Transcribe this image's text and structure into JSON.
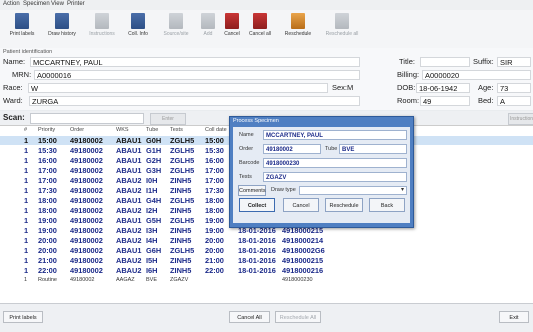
{
  "menu": [
    "Action",
    "Specimen",
    "View",
    "Printer"
  ],
  "toolbar": [
    {
      "label": "Print labels",
      "icon": "print-labels-icon",
      "enabled": true
    },
    {
      "label": "Draw history",
      "icon": "draw-history-icon",
      "enabled": true
    },
    {
      "label": "Instructions",
      "icon": "instructions-icon",
      "enabled": false
    },
    {
      "label": "Coll. Info",
      "icon": "collection-info-icon",
      "enabled": true
    },
    {
      "label": "Source/site",
      "icon": "source-site-icon",
      "enabled": false
    },
    {
      "label": "Add",
      "icon": "add-icon",
      "enabled": false
    },
    {
      "label": "Cancel",
      "icon": "cancel-icon",
      "enabled": true
    },
    {
      "label": "Cancel all",
      "icon": "cancel-all-icon",
      "enabled": true
    },
    {
      "label": "Reschedule",
      "icon": "reschedule-icon",
      "enabled": true
    },
    {
      "label": "Reschedule all",
      "icon": "reschedule-all-icon",
      "enabled": false
    }
  ],
  "patient": {
    "section_title": "Patient identification",
    "name_label": "Name:",
    "name": "MCCARTNEY, PAUL",
    "mrn_label": "MRN:",
    "mrn": "A0000016",
    "race_label": "Race:",
    "race": "W",
    "ward_label": "Ward:",
    "ward": "ZURGA",
    "sex_label": "Sex:",
    "sex": "M",
    "title_label": "Title:",
    "title": "",
    "suffix_label": "Suffix:",
    "suffix": "SIR",
    "billing_label": "Billing:",
    "billing": "A0000020",
    "dob_label": "DOB:",
    "dob": "18-06-1942",
    "age_label": "Age:",
    "age": "73",
    "room_label": "Room:",
    "room": "49",
    "bed_label": "Bed:",
    "bed": "A"
  },
  "scan": {
    "label": "Scan:",
    "enter_label": "Enter",
    "extra_label": "Instruction"
  },
  "grid": {
    "headers": [
      "#",
      "Priority",
      "Order",
      "WKS",
      "Tube",
      "Tests",
      "Coll date"
    ],
    "rows": [
      [
        "1",
        "15:00",
        "49180002",
        "ABAU1",
        "G0H",
        "ZGLH5",
        "15:00",
        "",
        ""
      ],
      [
        "1",
        "15:30",
        "49180002",
        "ABAU1",
        "G1H",
        "ZGLH5",
        "15:30",
        "",
        ""
      ],
      [
        "1",
        "16:00",
        "49180002",
        "ABAU1",
        "G2H",
        "ZGLH5",
        "16:00",
        "",
        ""
      ],
      [
        "1",
        "17:00",
        "49180002",
        "ABAU1",
        "G3H",
        "ZGLH5",
        "17:00",
        "",
        ""
      ],
      [
        "1",
        "17:00",
        "49180002",
        "ABAU2",
        "I0H",
        "ZINH5",
        "17:00",
        "",
        ""
      ],
      [
        "1",
        "17:30",
        "49180002",
        "ABAU2",
        "I1H",
        "ZINH5",
        "17:30",
        "",
        ""
      ],
      [
        "1",
        "18:00",
        "49180002",
        "ABAU1",
        "G4H",
        "ZGLH5",
        "18:00",
        "",
        ""
      ],
      [
        "1",
        "18:00",
        "49180002",
        "ABAU2",
        "I2H",
        "ZINH5",
        "18:00",
        "",
        ""
      ],
      [
        "1",
        "19:00",
        "49180002",
        "ABAU1",
        "G5H",
        "ZGLH5",
        "19:00",
        "",
        ""
      ],
      [
        "1",
        "19:00",
        "49180002",
        "ABAU2",
        "I3H",
        "ZINH5",
        "19:00",
        "18-01-2016",
        "4918000215"
      ],
      [
        "1",
        "20:00",
        "49180002",
        "ABAU2",
        "I4H",
        "ZINH5",
        "20:00",
        "18-01-2016",
        "4918000214"
      ],
      [
        "1",
        "20:00",
        "49180002",
        "ABAU1",
        "G6H",
        "ZGLH5",
        "20:00",
        "18-01-2016",
        "49180002G6"
      ],
      [
        "1",
        "21:00",
        "49180002",
        "ABAU2",
        "I5H",
        "ZINH5",
        "21:00",
        "18-01-2016",
        "4918000215"
      ],
      [
        "1",
        "22:00",
        "49180002",
        "ABAU2",
        "I6H",
        "ZINH5",
        "22:00",
        "18-01-2016",
        "4918000216"
      ],
      [
        "1",
        "Routine",
        "49180002",
        "AAGAZ",
        "BVE",
        "ZGAZV",
        "",
        "",
        "4918000230"
      ]
    ]
  },
  "footer": {
    "print_labels": "Print labels",
    "cancel_all": "Cancel All",
    "reschedule_all": "Reschedule All",
    "exit": "Exit"
  },
  "dialog": {
    "title": "Process Specimen",
    "name_label": "Name",
    "name": "MCCARTNEY, PAUL",
    "order_label": "Order",
    "order": "49180002",
    "tube_label": "Tube",
    "tube": "BVE",
    "barcode_label": "Barcode",
    "barcode": "4918000230",
    "tests_label": "Tests",
    "tests": "ZGAZV",
    "comments_label": "Comments",
    "draw_type_label": "Draw type",
    "collect_label": "Collect",
    "cancel_label": "Cancel",
    "reschedule_label": "Reschedule",
    "back_label": "Back"
  }
}
